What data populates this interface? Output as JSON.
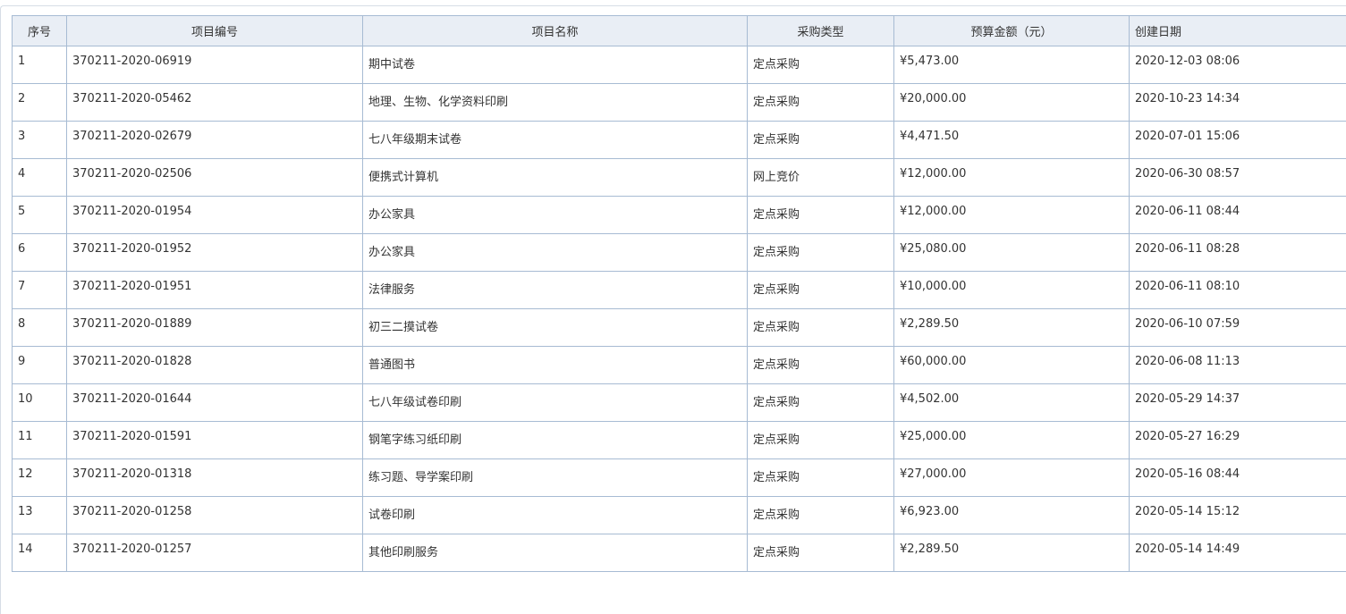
{
  "table": {
    "columns": [
      "序号",
      "项目编号",
      "项目名称",
      "采购类型",
      "预算金额（元）",
      "创建日期"
    ],
    "rows": [
      [
        "1",
        "370211-2020-06919",
        "期中试卷",
        "定点采购",
        "¥5,473.00",
        "2020-12-03 08:06"
      ],
      [
        "2",
        "370211-2020-05462",
        "地理、生物、化学资料印刷",
        "定点采购",
        "¥20,000.00",
        "2020-10-23 14:34"
      ],
      [
        "3",
        "370211-2020-02679",
        "七八年级期末试卷",
        "定点采购",
        "¥4,471.50",
        "2020-07-01 15:06"
      ],
      [
        "4",
        "370211-2020-02506",
        "便携式计算机",
        "网上竞价",
        "¥12,000.00",
        "2020-06-30 08:57"
      ],
      [
        "5",
        "370211-2020-01954",
        "办公家具",
        "定点采购",
        "¥12,000.00",
        "2020-06-11 08:44"
      ],
      [
        "6",
        "370211-2020-01952",
        "办公家具",
        "定点采购",
        "¥25,080.00",
        "2020-06-11 08:28"
      ],
      [
        "7",
        "370211-2020-01951",
        "法律服务",
        "定点采购",
        "¥10,000.00",
        "2020-06-11 08:10"
      ],
      [
        "8",
        "370211-2020-01889",
        "初三二摸试卷",
        "定点采购",
        "¥2,289.50",
        "2020-06-10 07:59"
      ],
      [
        "9",
        "370211-2020-01828",
        "普通图书",
        "定点采购",
        "¥60,000.00",
        "2020-06-08 11:13"
      ],
      [
        "10",
        "370211-2020-01644",
        "七八年级试卷印刷",
        "定点采购",
        "¥4,502.00",
        "2020-05-29 14:37"
      ],
      [
        "11",
        "370211-2020-01591",
        "钢笔字练习纸印刷",
        "定点采购",
        "¥25,000.00",
        "2020-05-27 16:29"
      ],
      [
        "12",
        "370211-2020-01318",
        "练习题、导学案印刷",
        "定点采购",
        "¥27,000.00",
        "2020-05-16 08:44"
      ],
      [
        "13",
        "370211-2020-01258",
        "试卷印刷",
        "定点采购",
        "¥6,923.00",
        "2020-05-14 15:12"
      ],
      [
        "14",
        "370211-2020-01257",
        "其他印刷服务",
        "定点采购",
        "¥2,289.50",
        "2020-05-14 14:49"
      ]
    ]
  }
}
